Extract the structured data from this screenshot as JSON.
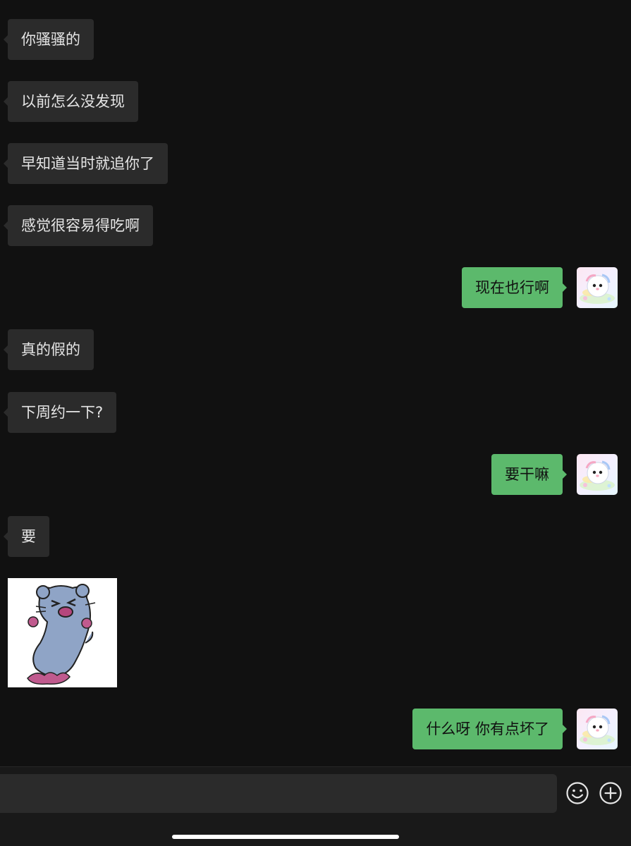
{
  "messages": [
    {
      "side": "in",
      "text": "你骚骚的"
    },
    {
      "side": "in",
      "text": "以前怎么没发现"
    },
    {
      "side": "in",
      "text": "早知道当时就追你了"
    },
    {
      "side": "in",
      "text": "感觉很容易得吃啊"
    },
    {
      "side": "out",
      "text": "现在也行啊"
    },
    {
      "side": "in",
      "text": "真的假的"
    },
    {
      "side": "in",
      "text": "下周约一下?"
    },
    {
      "side": "out",
      "text": "要干嘛"
    },
    {
      "side": "in",
      "text": "要"
    },
    {
      "side": "in",
      "type": "sticker",
      "sticker": "blue-hamster-sticker"
    },
    {
      "side": "out",
      "text": "什么呀 你有点坏了"
    }
  ],
  "input_bar": {
    "value": "",
    "emoji_icon": "smiley-face-icon",
    "plus_icon": "plus-circle-icon"
  },
  "colors": {
    "background": "#111111",
    "incoming_bubble": "#2b2b2b",
    "outgoing_bubble": "#5cb96c"
  }
}
